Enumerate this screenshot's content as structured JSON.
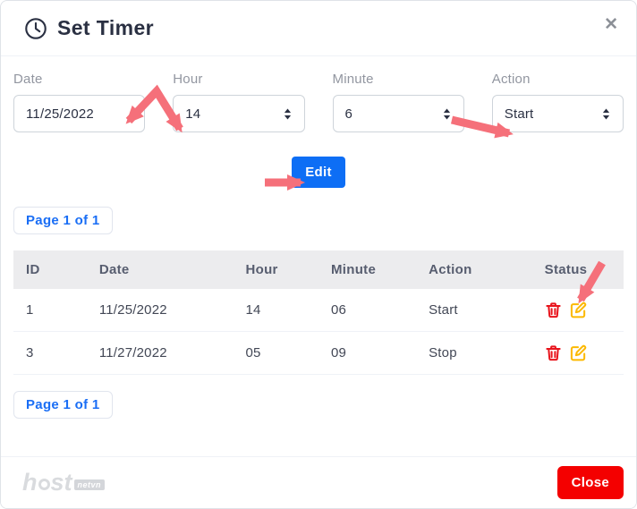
{
  "header": {
    "title": "Set Timer"
  },
  "form": {
    "date": {
      "label": "Date",
      "value": "11/25/2022"
    },
    "hour": {
      "label": "Hour",
      "value": "14"
    },
    "minute": {
      "label": "Minute",
      "value": "6"
    },
    "action": {
      "label": "Action",
      "value": "Start"
    },
    "edit_button": "Edit"
  },
  "pagination": {
    "top": "Page 1 of 1",
    "bottom": "Page 1 of 1"
  },
  "table": {
    "headers": [
      "ID",
      "Date",
      "Hour",
      "Minute",
      "Action",
      "Status"
    ],
    "rows": [
      {
        "id": "1",
        "date": "11/25/2022",
        "hour": "14",
        "minute": "06",
        "action": "Start"
      },
      {
        "id": "3",
        "date": "11/27/2022",
        "hour": "05",
        "minute": "09",
        "action": "Stop"
      }
    ]
  },
  "footer": {
    "logo": {
      "prefix": "h",
      "suffix": "st",
      "badge": "netvn"
    },
    "close_button": "Close"
  },
  "icons": {
    "title": "clock",
    "close": "x",
    "select": "up-down-caret",
    "delete": "trash",
    "edit": "pencil-square"
  },
  "colors": {
    "accent_blue": "#0d6ef5",
    "link_blue": "#1a6ef5",
    "close_red": "#f40000",
    "trash_red": "#e8141c",
    "edit_yellow": "#fcb900",
    "arrow_pink": "#f5707a",
    "title_text": "#2a3042",
    "table_header_bg": "#ececee"
  }
}
